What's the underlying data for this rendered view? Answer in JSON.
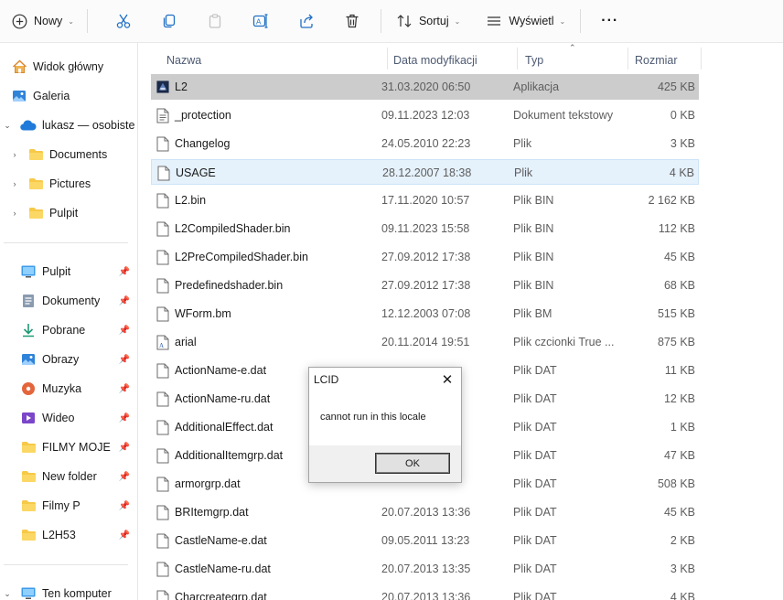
{
  "toolbar": {
    "new_label": "Nowy",
    "sort_label": "Sortuj",
    "view_label": "Wyświetl",
    "more_label": "···",
    "icons": [
      "new-icon",
      "cut-icon",
      "copy-icon",
      "paste-icon",
      "rename-icon",
      "share-icon",
      "delete-icon",
      "sort-icon",
      "view-icon",
      "more-icon"
    ]
  },
  "sidebar": {
    "top": [
      {
        "label": "Widok główny",
        "icon": "home-icon"
      },
      {
        "label": "Galeria",
        "icon": "gallery-icon"
      },
      {
        "label": "lukasz — osobiste",
        "icon": "onedrive-icon"
      },
      {
        "label": "Documents",
        "icon": "folder-icon"
      },
      {
        "label": "Pictures",
        "icon": "folder-icon"
      },
      {
        "label": "Pulpit",
        "icon": "folder-icon"
      }
    ],
    "quick": [
      {
        "label": "Pulpit",
        "icon": "desktop-icon"
      },
      {
        "label": "Dokumenty",
        "icon": "documents-icon"
      },
      {
        "label": "Pobrane",
        "icon": "download-icon"
      },
      {
        "label": "Obrazy",
        "icon": "pictures-icon"
      },
      {
        "label": "Muzyka",
        "icon": "music-icon"
      },
      {
        "label": "Wideo",
        "icon": "video-icon"
      },
      {
        "label": "FILMY MOJE",
        "icon": "folder-icon"
      },
      {
        "label": "New folder",
        "icon": "folder-icon"
      },
      {
        "label": "Filmy P",
        "icon": "folder-icon"
      },
      {
        "label": "L2H53",
        "icon": "folder-icon"
      }
    ],
    "this_pc": {
      "label": "Ten komputer",
      "icon": "computer-icon"
    }
  },
  "columns": {
    "name": "Nazwa",
    "date": "Data modyfikacji",
    "type": "Typ",
    "size": "Rozmiar"
  },
  "files": [
    {
      "name": "L2",
      "date": "31.03.2020 06:50",
      "type": "Aplikacja",
      "size": "425 KB",
      "icon": "app-icon"
    },
    {
      "name": "_protection",
      "date": "09.11.2023 12:03",
      "type": "Dokument tekstowy",
      "size": "0 KB",
      "icon": "text-file-icon"
    },
    {
      "name": "Changelog",
      "date": "24.05.2010 22:23",
      "type": "Plik",
      "size": "3 KB",
      "icon": "file-icon"
    },
    {
      "name": "USAGE",
      "date": "28.12.2007 18:38",
      "type": "Plik",
      "size": "4 KB",
      "icon": "file-icon"
    },
    {
      "name": "L2.bin",
      "date": "17.11.2020 10:57",
      "type": "Plik BIN",
      "size": "2 162 KB",
      "icon": "file-icon"
    },
    {
      "name": "L2CompiledShader.bin",
      "date": "09.11.2023 15:58",
      "type": "Plik BIN",
      "size": "112 KB",
      "icon": "file-icon"
    },
    {
      "name": "L2PreCompiledShader.bin",
      "date": "27.09.2012 17:38",
      "type": "Plik BIN",
      "size": "45 KB",
      "icon": "file-icon"
    },
    {
      "name": "Predefinedshader.bin",
      "date": "27.09.2012 17:38",
      "type": "Plik BIN",
      "size": "68 KB",
      "icon": "file-icon"
    },
    {
      "name": "WForm.bm",
      "date": "12.12.2003 07:08",
      "type": "Plik BM",
      "size": "515 KB",
      "icon": "file-icon"
    },
    {
      "name": "arial",
      "date": "20.11.2014 19:51",
      "type": "Plik czcionki True ...",
      "size": "875 KB",
      "icon": "font-file-icon"
    },
    {
      "name": "ActionName-e.dat",
      "date": "",
      "type": "Plik DAT",
      "size": "11 KB",
      "icon": "file-icon"
    },
    {
      "name": "ActionName-ru.dat",
      "date": "",
      "type": "Plik DAT",
      "size": "12 KB",
      "icon": "file-icon"
    },
    {
      "name": "AdditionalEffect.dat",
      "date": "",
      "type": "Plik DAT",
      "size": "1 KB",
      "icon": "file-icon"
    },
    {
      "name": "AdditionalItemgrp.dat",
      "date": "",
      "type": "Plik DAT",
      "size": "47 KB",
      "icon": "file-icon"
    },
    {
      "name": "armorgrp.dat",
      "date": "",
      "type": "Plik DAT",
      "size": "508 KB",
      "icon": "file-icon"
    },
    {
      "name": "BRItemgrp.dat",
      "date": "20.07.2013 13:36",
      "type": "Plik DAT",
      "size": "45 KB",
      "icon": "file-icon"
    },
    {
      "name": "CastleName-e.dat",
      "date": "09.05.2011 13:23",
      "type": "Plik DAT",
      "size": "2 KB",
      "icon": "file-icon"
    },
    {
      "name": "CastleName-ru.dat",
      "date": "20.07.2013 13:35",
      "type": "Plik DAT",
      "size": "3 KB",
      "icon": "file-icon"
    },
    {
      "name": "Charcreategrp.dat",
      "date": "20.07.2013 13:36",
      "type": "Plik DAT",
      "size": "4 KB",
      "icon": "file-icon"
    }
  ],
  "dialog": {
    "title": "LCID",
    "message": "cannot run in this locale",
    "ok_label": "OK"
  }
}
